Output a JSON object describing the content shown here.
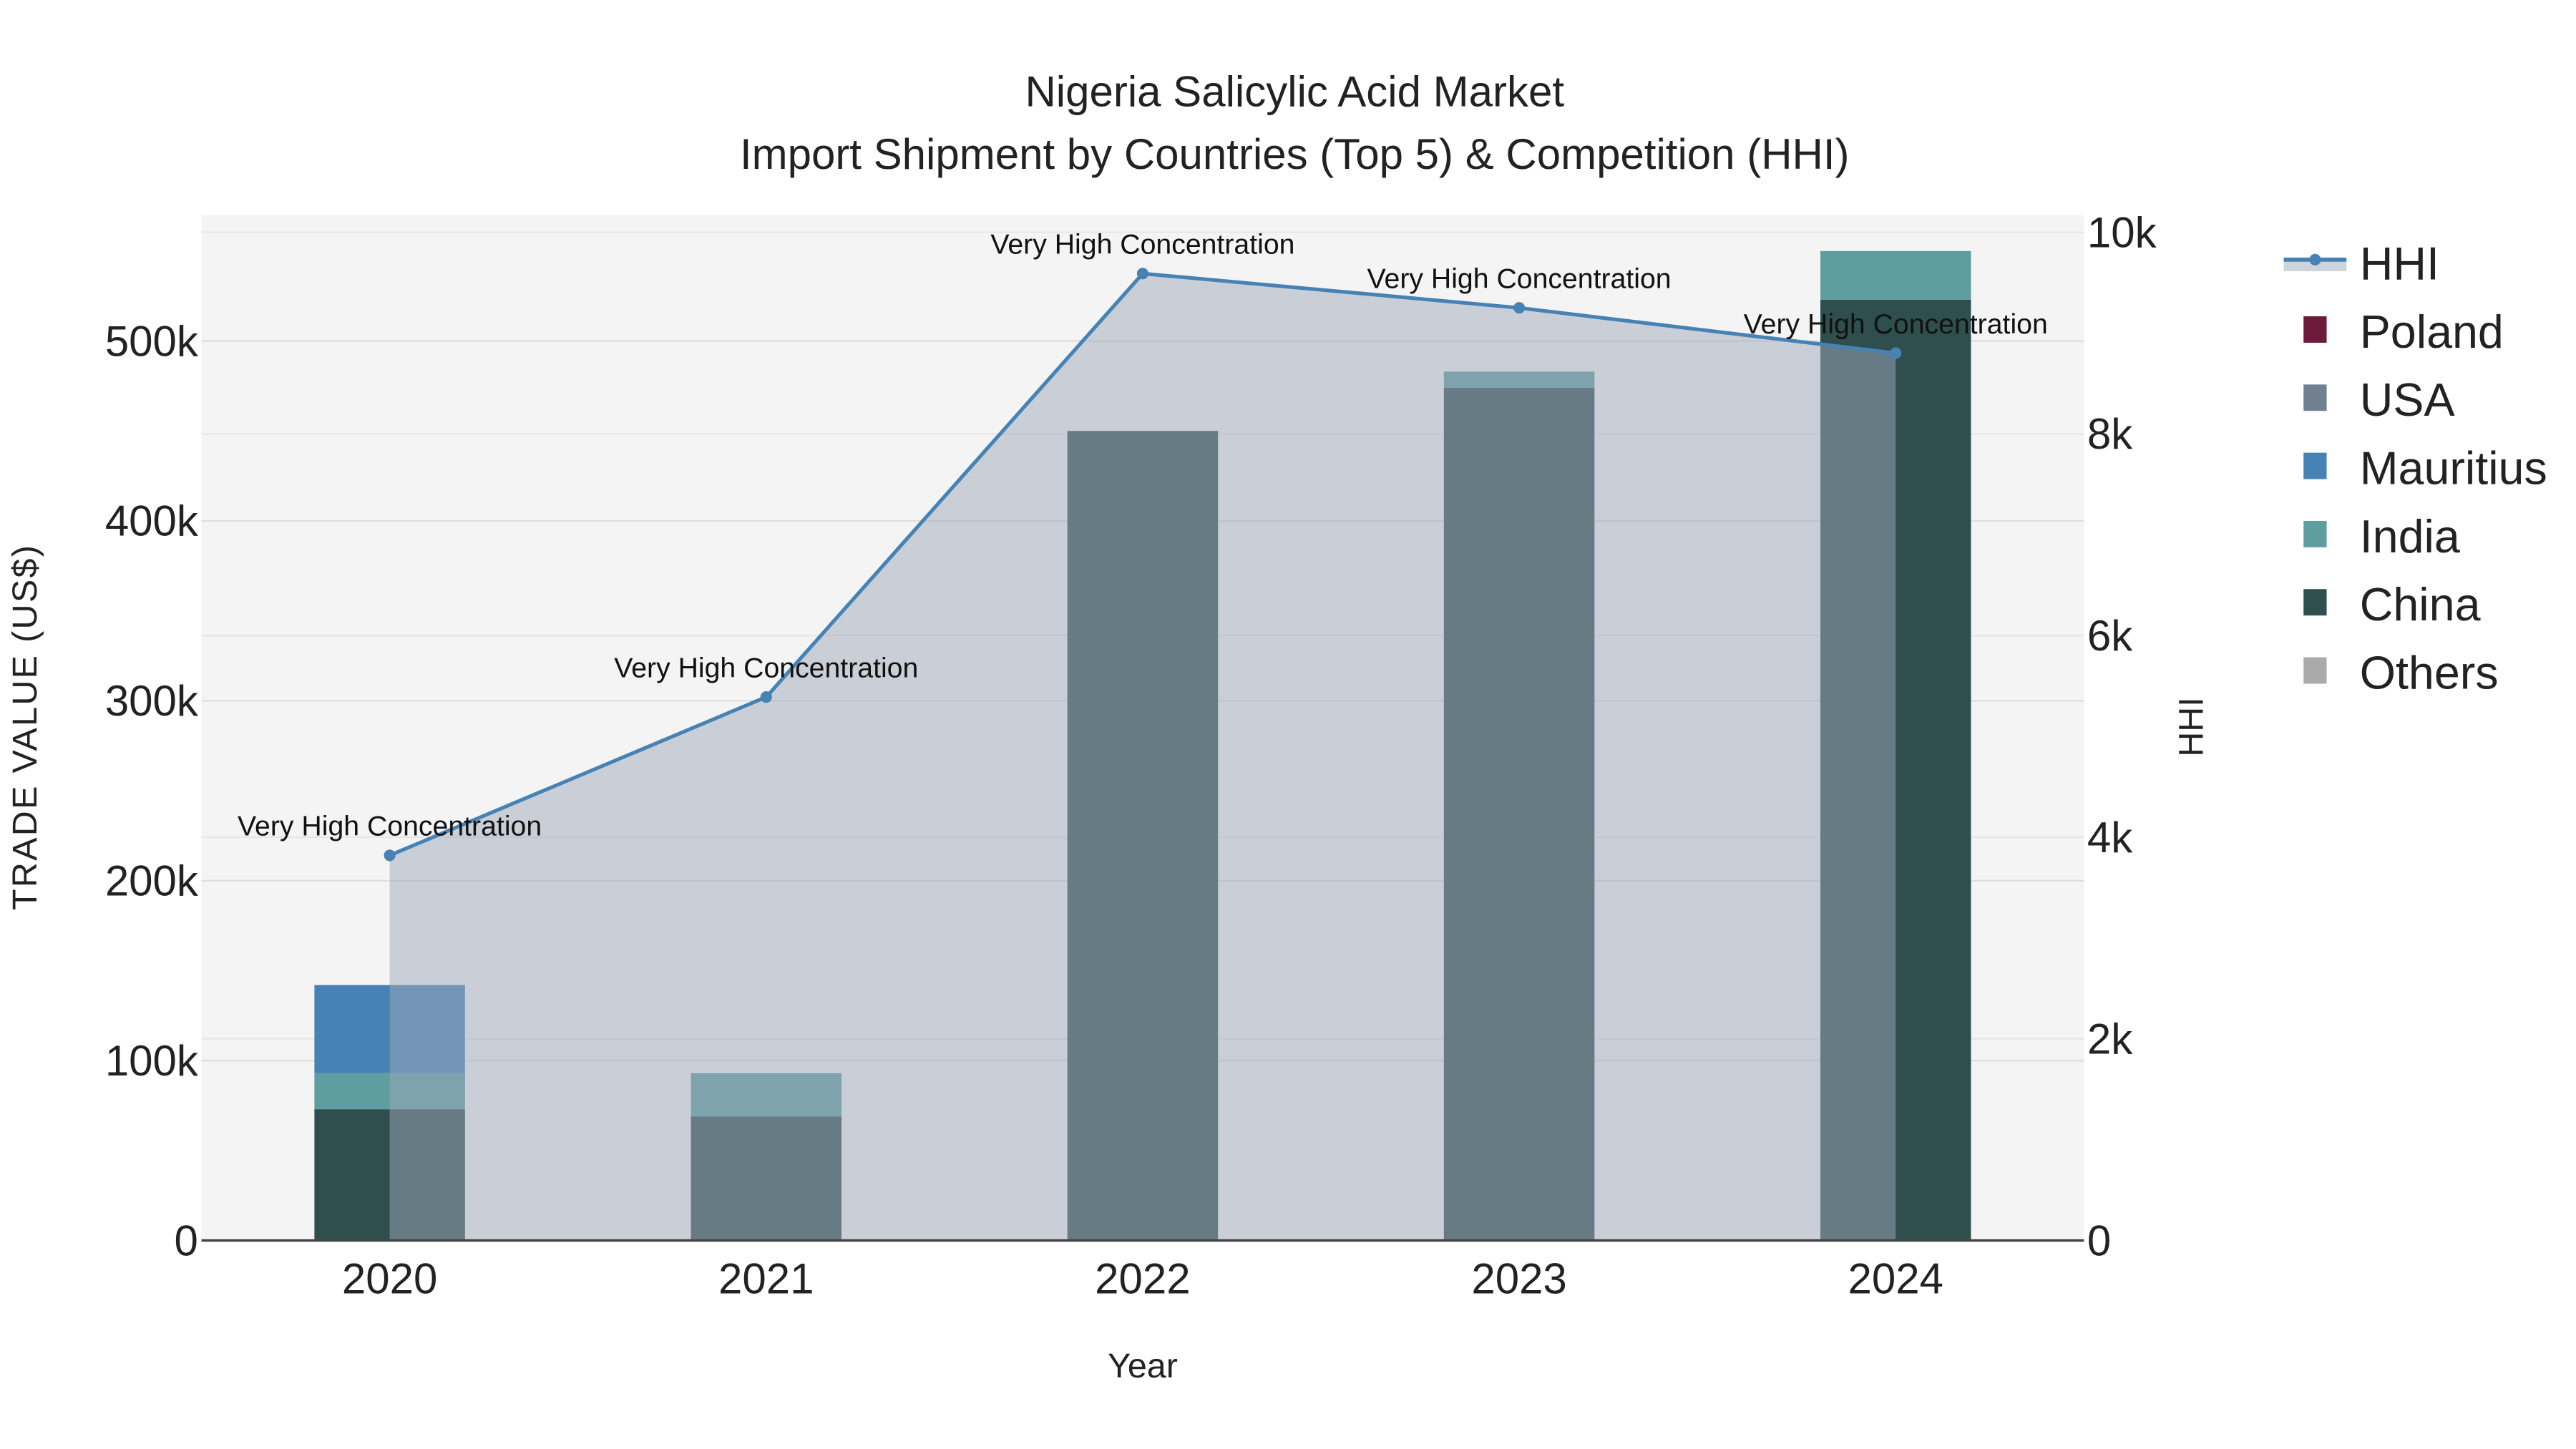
{
  "chart_data": {
    "type": "bar",
    "title": "Nigeria Salicylic Acid Market",
    "subtitle": "Import Shipment by Countries (Top 5) & Competition (HHI)",
    "xlabel": "Year",
    "ylabel": "TRADE VALUE (US$)",
    "y2label": "HHI",
    "categories": [
      "2020",
      "2021",
      "2022",
      "2023",
      "2024"
    ],
    "ylim": [
      0,
      570000
    ],
    "y2lim": [
      0,
      10170
    ],
    "yticks": [
      0,
      100000,
      200000,
      300000,
      400000,
      500000
    ],
    "ytick_labels": [
      "0",
      "100k",
      "200k",
      "300k",
      "400k",
      "500k"
    ],
    "y2ticks": [
      0,
      2000,
      4000,
      6000,
      8000,
      10000
    ],
    "y2tick_labels": [
      "0",
      "2k",
      "4k",
      "6k",
      "8k",
      "10k"
    ],
    "barmode": "stack",
    "series": [
      {
        "name": "China",
        "color": "#2f4f4f",
        "values": [
          73000,
          69000,
          450000,
          474000,
          523000
        ]
      },
      {
        "name": "India",
        "color": "#5f9ea0",
        "values": [
          20000,
          24000,
          0,
          9000,
          27000
        ]
      },
      {
        "name": "Mauritius",
        "color": "#4682b4",
        "values": [
          49000,
          0,
          0,
          0,
          0
        ]
      },
      {
        "name": "USA",
        "color": "#708090",
        "values": [
          0,
          0,
          0,
          0,
          0
        ]
      },
      {
        "name": "Poland",
        "color": "#6b1a3a",
        "values": [
          0,
          0,
          0,
          0,
          0
        ]
      },
      {
        "name": "Others",
        "color": "#aaaaaa",
        "values": [
          0,
          0,
          0,
          0,
          0
        ]
      }
    ],
    "hhi": {
      "name": "HHI",
      "color": "#4682b4",
      "values": [
        3820,
        5390,
        9590,
        9250,
        8800
      ],
      "annotations": [
        "Very High Concentration",
        "Very High Concentration",
        "Very High Concentration",
        "Very High Concentration",
        "Very High Concentration"
      ]
    },
    "legend": {
      "placement": "right",
      "entries": [
        "HHI",
        "Poland",
        "USA",
        "Mauritius",
        "India",
        "China",
        "Others"
      ]
    },
    "grid": true
  }
}
